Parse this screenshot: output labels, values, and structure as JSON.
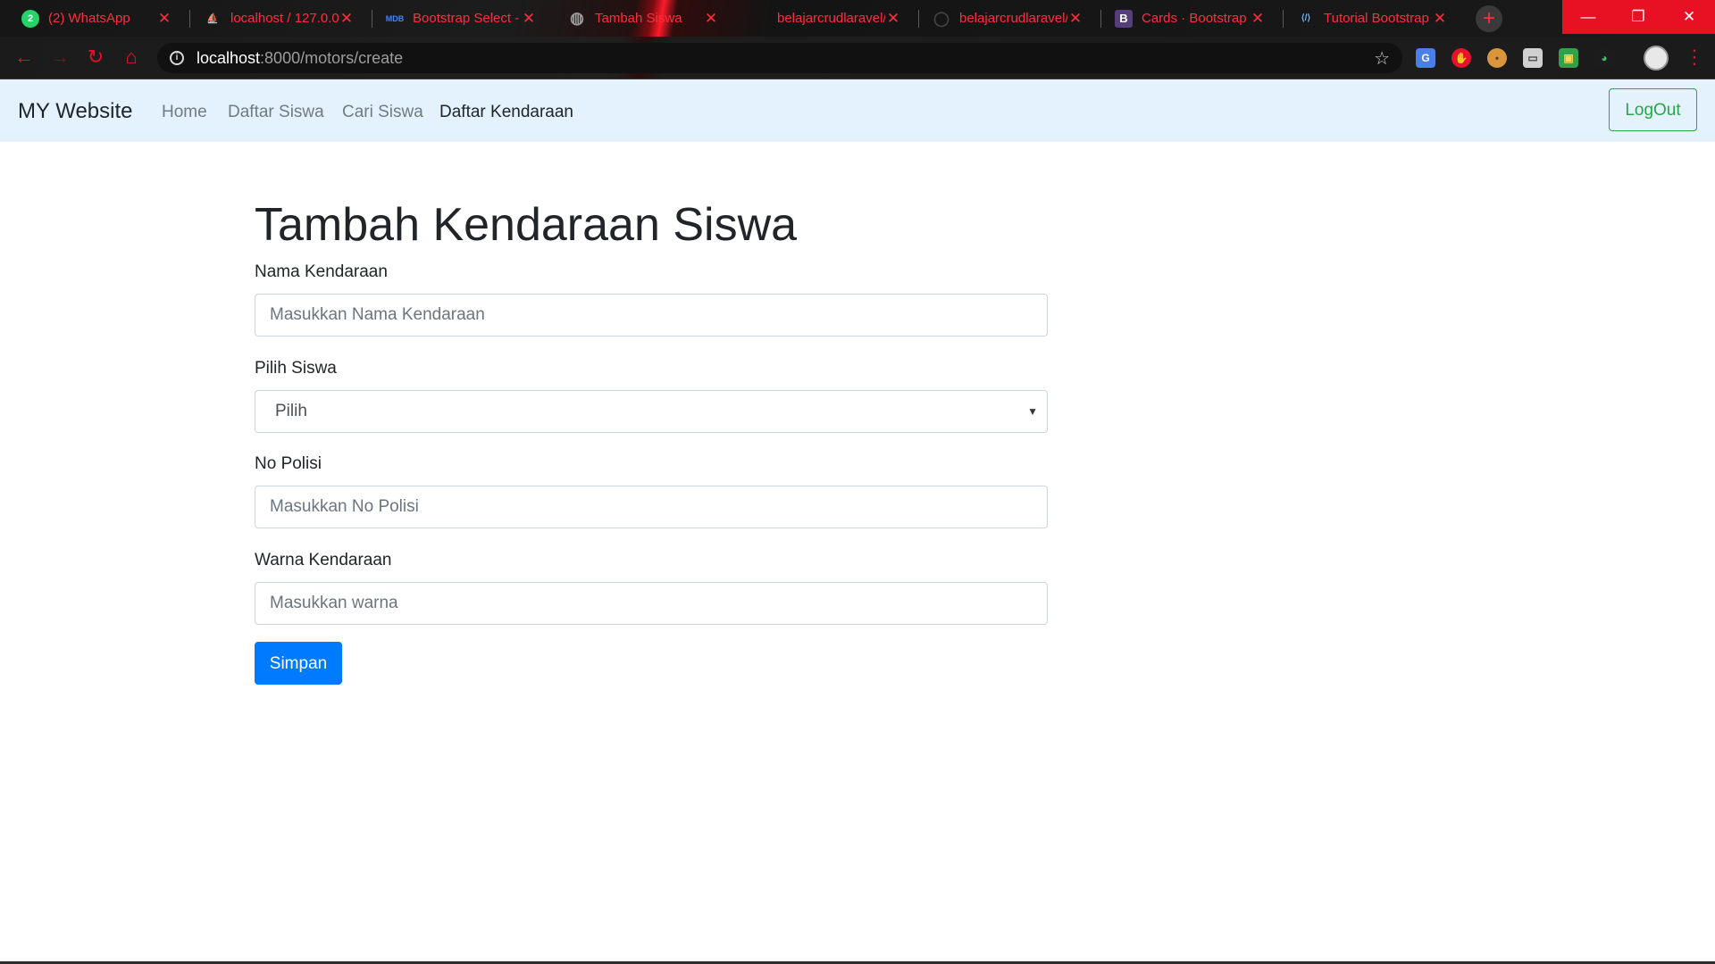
{
  "browser": {
    "tabs": [
      {
        "title": "(2) WhatsApp",
        "favicon": "whatsapp-icon",
        "glyph": "2"
      },
      {
        "title": "localhost / 127.0.0.",
        "favicon": "phpmyadmin-icon",
        "glyph": "⛵"
      },
      {
        "title": "Bootstrap Select -",
        "favicon": "mdb-icon",
        "glyph": "MDB"
      },
      {
        "title": "Tambah Siswa",
        "favicon": "globe-icon",
        "glyph": "◍"
      },
      {
        "title": "belajarcrudlaravel/",
        "favicon": "github-icon",
        "glyph": ""
      },
      {
        "title": "belajarcrudlaravel/",
        "favicon": "github-icon",
        "glyph": "◯"
      },
      {
        "title": "Cards · Bootstrap",
        "favicon": "bootstrap-icon",
        "glyph": "B"
      },
      {
        "title": "Tutorial Bootstrap",
        "favicon": "webdev-icon",
        "glyph": "⟨/⟩"
      }
    ],
    "close_glyph": "✕",
    "new_tab_glyph": "+",
    "window_controls": {
      "minimize": "—",
      "restore": "❐",
      "close": "✕"
    },
    "url_host": "localhost",
    "url_rest": ":8000/motors/create",
    "accent_color": "#ff2d3d"
  },
  "navbar": {
    "brand": "MY Website",
    "links": [
      "Home",
      "Daftar Siswa",
      "Cari Siswa",
      "Daftar Kendaraan"
    ],
    "active_link": "Daftar Kendaraan",
    "logout_label": "LogOut",
    "background": "#e3f2fd"
  },
  "form": {
    "title": "Tambah Kendaraan Siswa",
    "nama_label": "Nama Kendaraan",
    "nama_placeholder": "Masukkan Nama Kendaraan",
    "siswa_label": "Pilih Siswa",
    "siswa_selected": "Pilih",
    "nopol_label": "No Polisi",
    "nopol_placeholder": "Masukkan No Polisi",
    "warna_label": "Warna Kendaraan",
    "warna_placeholder": "Masukkan warna",
    "submit_label": "Simpan",
    "submit_color": "#007bff"
  }
}
